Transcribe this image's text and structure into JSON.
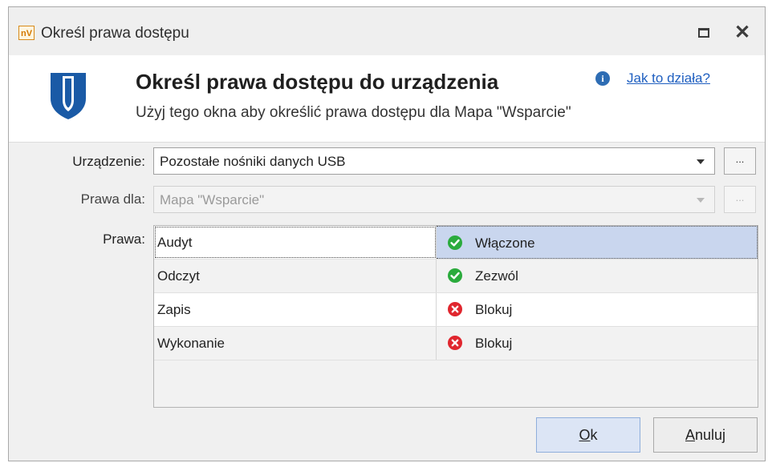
{
  "window": {
    "app_icon_text": "nV",
    "title": "Określ prawa dostępu"
  },
  "header": {
    "title": "Określ prawa dostępu do urządzenia",
    "subtitle": "Użyj tego okna aby określić prawa dostępu dla Mapa \"Wsparcie\"",
    "help_link": "Jak to działa?",
    "info_icon_text": "i"
  },
  "form": {
    "device_label": "Urządzenie:",
    "device_value": "Pozostałe nośniki danych USB",
    "rights_for_label": "Prawa dla:",
    "rights_for_value": "Mapa \"Wsparcie\"",
    "rights_label": "Prawa:",
    "browse_label": "..."
  },
  "rights": [
    {
      "name": "Audyt",
      "status": "Włączone",
      "icon": "check-icon",
      "color": "#2bab3d"
    },
    {
      "name": "Odczyt",
      "status": "Zezwól",
      "icon": "check-icon",
      "color": "#2bab3d"
    },
    {
      "name": "Zapis",
      "status": "Blokuj",
      "icon": "block-icon",
      "color": "#e0262e"
    },
    {
      "name": "Wykonanie",
      "status": "Blokuj",
      "icon": "block-icon",
      "color": "#e0262e"
    }
  ],
  "buttons": {
    "ok_mnemonic": "O",
    "ok_rest": "k",
    "cancel_mnemonic": "A",
    "cancel_rest": "nuluj"
  },
  "colors": {
    "shield": "#1a5aa6",
    "selection": "#c9d6ee",
    "link": "#1f5fc0"
  }
}
